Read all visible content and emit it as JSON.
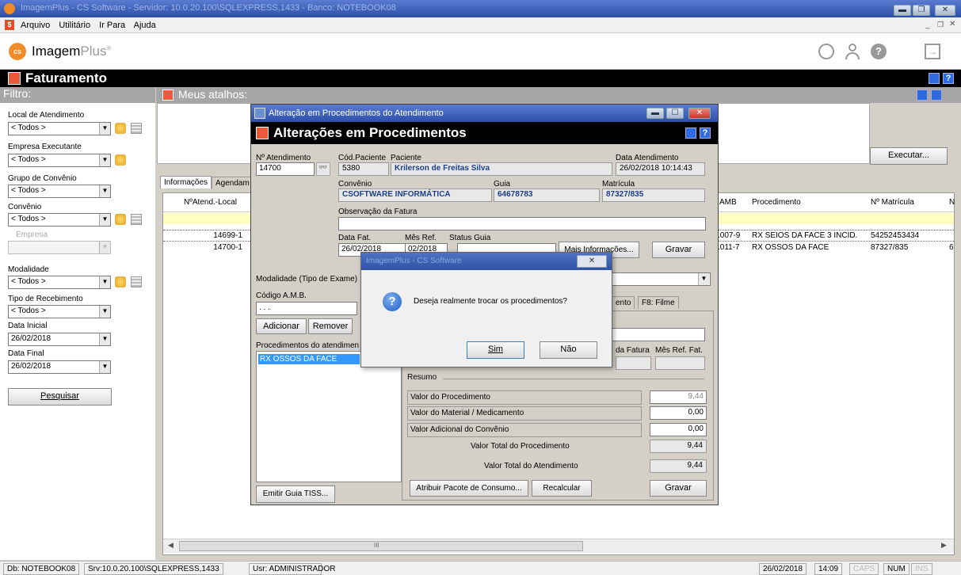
{
  "window": {
    "title": "ImagemPlus - CS Software - Servidor: 10.0.20.100\\SQLEXPRESS,1433 - Banco: NOTEBOOK08"
  },
  "menu": [
    "Arquivo",
    "Utilitário",
    "Ir Para",
    "Ajuda"
  ],
  "logo": {
    "brand": "Imagem",
    "brand2": "Plus",
    "reg": "®"
  },
  "module": {
    "title": "Faturamento"
  },
  "filter": {
    "header": "Filtro:",
    "local_label": "Local de Atendimento",
    "local_value": "< Todos >",
    "empresa_exec_label": "Empresa Executante",
    "empresa_exec_value": "< Todos >",
    "grupo_label": "Grupo de Convênio",
    "grupo_value": "< Todos >",
    "convenio_label": "Convênio",
    "convenio_value": "< Todos >",
    "empresa_label": "Empresa",
    "modalidade_label": "Modalidade",
    "modalidade_value": "< Todos >",
    "tipo_receb_label": "Tipo de Recebimento",
    "tipo_receb_value": "< Todos >",
    "data_ini_label": "Data Inicial",
    "data_ini_value": "26/02/2018",
    "data_fim_label": "Data Final",
    "data_fim_value": "26/02/2018",
    "search_button": "Pesquisar"
  },
  "shortcuts": {
    "header": "Meus atalhos:",
    "execute_button": "Executar..."
  },
  "tabs": [
    "Informações",
    "Agendam"
  ],
  "grid": {
    "left_header": "NºAtend.-Local",
    "rows_left": [
      "14699-1",
      "14700-1"
    ],
    "right_headers": [
      "AMB",
      "Procedimento",
      "Nº Matrícula",
      "N"
    ],
    "rows_right": [
      [
        ".007-9",
        "RX SEIOS DA FACE 3 INCID.",
        "54252453434",
        ""
      ],
      [
        ".011-7",
        "RX OSSOS DA FACE",
        "87327/835",
        "6"
      ]
    ],
    "scroll_mark": "III"
  },
  "dialog": {
    "window_title": "Alteração em Procedimentos do Atendimento",
    "header": "Alterações em Procedimentos",
    "labels": {
      "atendimento": "Nº Atendimento",
      "cod_paciente": "Cód.Paciente",
      "paciente": "Paciente",
      "data_atend": "Data Atendimento",
      "convenio": "Convênio",
      "guia": "Guia",
      "matricula": "Matrícula",
      "obs_fatura": "Observação da Fatura",
      "data_fat": "Data Fat.",
      "mes_ref": "Mês Ref.",
      "status_guia": "Status Guia",
      "modalidade": "Modalidade (Tipo de Exame)",
      "codigo_amb": "Código A.M.B.",
      "procedimentos": "Procedimentos do atendiment",
      "resumo": "Resumo",
      "da_fatura": "da Fatura",
      "mes_ref_fat": "Mês Ref. Fat."
    },
    "values": {
      "atendimento": "14700",
      "cod_paciente": "5380",
      "paciente": "Krilerson de Freitas Silva",
      "data_atend": "26/02/2018 10:14:43",
      "convenio": "CSOFTWARE INFORMÁTICA",
      "guia": "64678783",
      "matricula": "87327/835",
      "data_fat": "26/02/2018",
      "mes_ref": "02/2018",
      "codigo_amb": ". . ."
    },
    "buttons": {
      "mais_info": "Mais Informações...",
      "gravar_top": "Gravar",
      "adicionar": "Adicionar",
      "remover": "Remover",
      "emitir": "Emitir Guia TISS...",
      "atribuir": "Atribuir Pacote de Consumo...",
      "recalcular": "Recalcular",
      "gravar_bottom": "Gravar"
    },
    "tabs": [
      "ento",
      "F8: Filme"
    ],
    "proc_list": [
      "RX OSSOS DA FACE"
    ],
    "resumo_rows": [
      {
        "label": "Valor do Procedimento",
        "value": "9,44"
      },
      {
        "label": "Valor do Material / Medicamento",
        "value": "0,00"
      },
      {
        "label": "Valor Adicional do Convênio",
        "value": "0,00"
      },
      {
        "label": "Valor Total do Procedimento",
        "value": "9,44"
      },
      {
        "label": "Valor Total do Atendimento",
        "value": "9,44"
      }
    ]
  },
  "confirm": {
    "title": "ImagemPlus - CS Software",
    "message": "Deseja realmente trocar os procedimentos?",
    "yes": "Sim",
    "no": "Não",
    "close": "✕"
  },
  "status": {
    "db": "Db: NOTEBOOK08",
    "srv": "Srv:10.0.20.100\\SQLEXPRESS,1433",
    "usr": "Usr: ADMINISTRADOR",
    "date": "26/02/2018",
    "time": "14:09",
    "caps": "CAPS",
    "num": "NUM",
    "ins": "INS"
  }
}
